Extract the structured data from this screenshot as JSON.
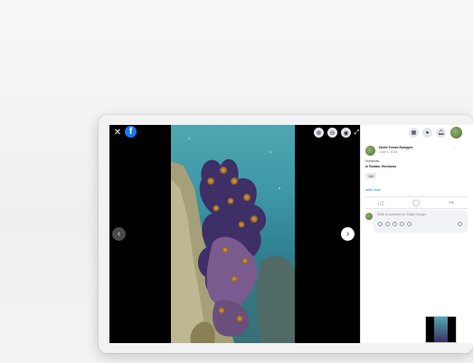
{
  "viewer": {
    "close_icon": "close-icon",
    "logo_letter": "f",
    "controls": [
      "zoom-in-icon",
      "zoom-out-icon",
      "tag-icon"
    ],
    "expand_icon": "expand-icon",
    "prev_arrow": "‹",
    "next_arrow": "›"
  },
  "panel": {
    "topbar_icons": [
      "menu-icon",
      "messenger-icon",
      "notifications-icon"
    ],
    "author": "David Tomas Ramppin",
    "timestamp": "June 8, 2018 · ",
    "caption_line1": "Honduras",
    "caption_line2": "in Roatan, Honduras",
    "chip_label": "140",
    "see_more": "Write More",
    "comment_placeholder": "Write a comment as Guitar Ranger",
    "more_dots": "···"
  },
  "colors": {
    "facebook_blue": "#1877f2"
  }
}
